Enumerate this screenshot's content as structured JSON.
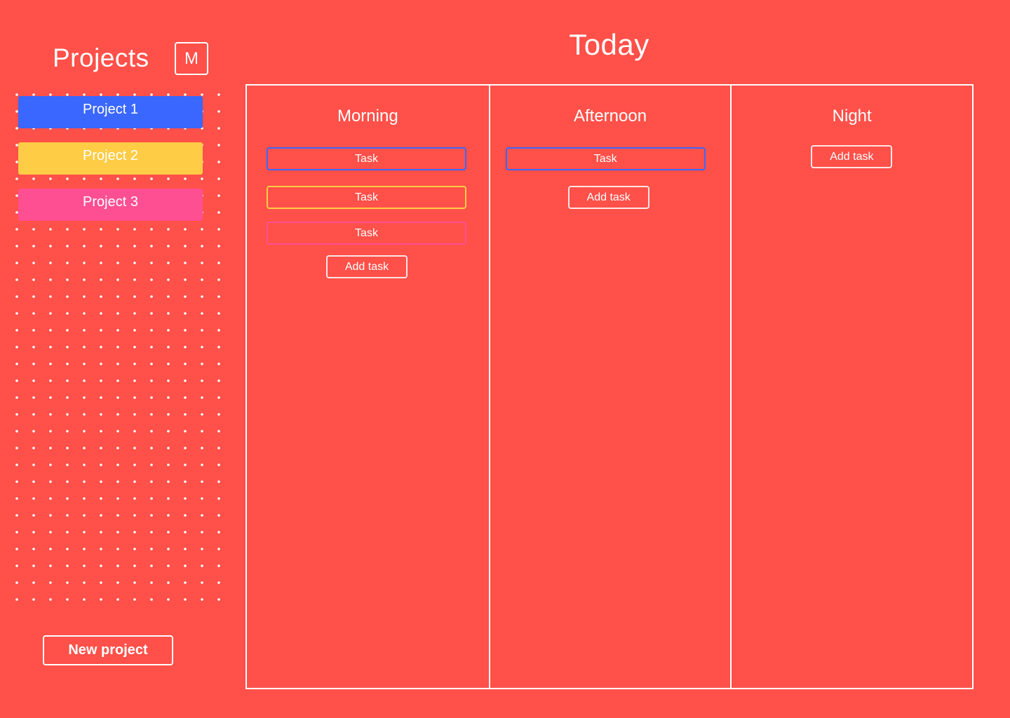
{
  "sidebar": {
    "title": "Projects",
    "menu_button_label": "M",
    "projects": [
      {
        "label": "Project 1",
        "color": "#3A67FF"
      },
      {
        "label": "Project 2",
        "color": "#FFCC46"
      },
      {
        "label": "Project 3",
        "color": "#FF4F93"
      }
    ],
    "new_project_label": "New project"
  },
  "main": {
    "title": "Today",
    "columns": [
      {
        "title": "Morning",
        "tasks": [
          {
            "label": "Task",
            "color": "#3A67FF"
          },
          {
            "label": "Task",
            "color": "#FFCC46"
          },
          {
            "label": "Task",
            "color": "#FF4F93"
          }
        ],
        "add_task_label": "Add task"
      },
      {
        "title": "Afternoon",
        "tasks": [
          {
            "label": "Task",
            "color": "#3A67FF"
          }
        ],
        "add_task_label": "Add task"
      },
      {
        "title": "Night",
        "tasks": [],
        "add_task_label": "Add task"
      }
    ]
  },
  "colors": {
    "background": "#FF5049",
    "foreground": "#FFFFFF"
  }
}
